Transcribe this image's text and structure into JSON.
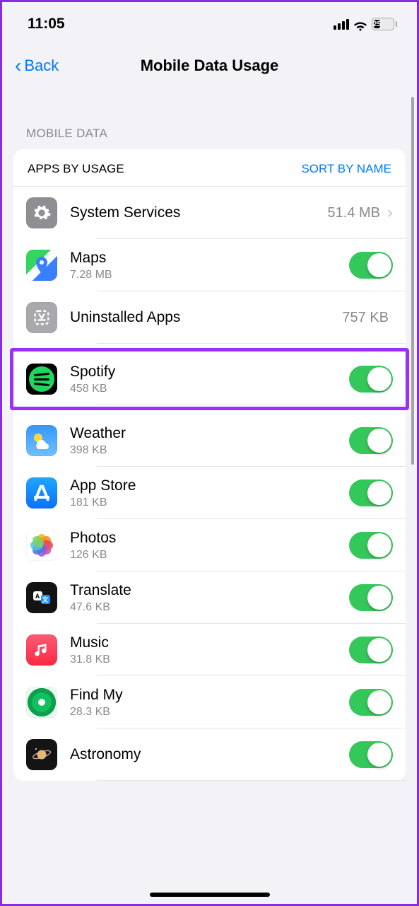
{
  "status": {
    "time": "11:05",
    "battery_text": "25"
  },
  "nav": {
    "back_label": "Back",
    "title": "Mobile Data Usage"
  },
  "section_header": "MOBILE DATA",
  "list_header": {
    "left": "APPS BY USAGE",
    "right": "SORT BY NAME"
  },
  "rows": [
    {
      "name": "System Services",
      "sub": "",
      "value": "51.4 MB",
      "type": "chevron",
      "icon": "ic-system",
      "icon_name": "settings-gear-icon"
    },
    {
      "name": "Maps",
      "sub": "7.28 MB",
      "value": "",
      "type": "toggle",
      "icon": "ic-maps",
      "icon_name": "maps-app-icon",
      "toggle_on": true
    },
    {
      "name": "Uninstalled Apps",
      "sub": "",
      "value": "757 KB",
      "type": "value",
      "icon": "ic-uninstalled",
      "icon_name": "uninstalled-apps-icon"
    },
    {
      "name": "Spotify",
      "sub": "458 KB",
      "value": "",
      "type": "toggle",
      "icon": "ic-spotify",
      "icon_name": "spotify-app-icon",
      "toggle_on": true,
      "highlighted": true
    },
    {
      "name": "Weather",
      "sub": "398 KB",
      "value": "",
      "type": "toggle",
      "icon": "ic-weather",
      "icon_name": "weather-app-icon",
      "toggle_on": true
    },
    {
      "name": "App Store",
      "sub": "181 KB",
      "value": "",
      "type": "toggle",
      "icon": "ic-appstore",
      "icon_name": "app-store-app-icon",
      "toggle_on": true
    },
    {
      "name": "Photos",
      "sub": "126 KB",
      "value": "",
      "type": "toggle",
      "icon": "ic-photos",
      "icon_name": "photos-app-icon",
      "toggle_on": true
    },
    {
      "name": "Translate",
      "sub": "47.6 KB",
      "value": "",
      "type": "toggle",
      "icon": "ic-translate",
      "icon_name": "translate-app-icon",
      "toggle_on": true
    },
    {
      "name": "Music",
      "sub": "31.8 KB",
      "value": "",
      "type": "toggle",
      "icon": "ic-music",
      "icon_name": "music-app-icon",
      "toggle_on": true
    },
    {
      "name": "Find My",
      "sub": "28.3 KB",
      "value": "",
      "type": "toggle",
      "icon": "ic-findmy",
      "icon_name": "find-my-app-icon",
      "toggle_on": true
    },
    {
      "name": "Astronomy",
      "sub": "",
      "value": "",
      "type": "toggle",
      "icon": "ic-astronomy",
      "icon_name": "astronomy-app-icon",
      "toggle_on": true
    }
  ]
}
